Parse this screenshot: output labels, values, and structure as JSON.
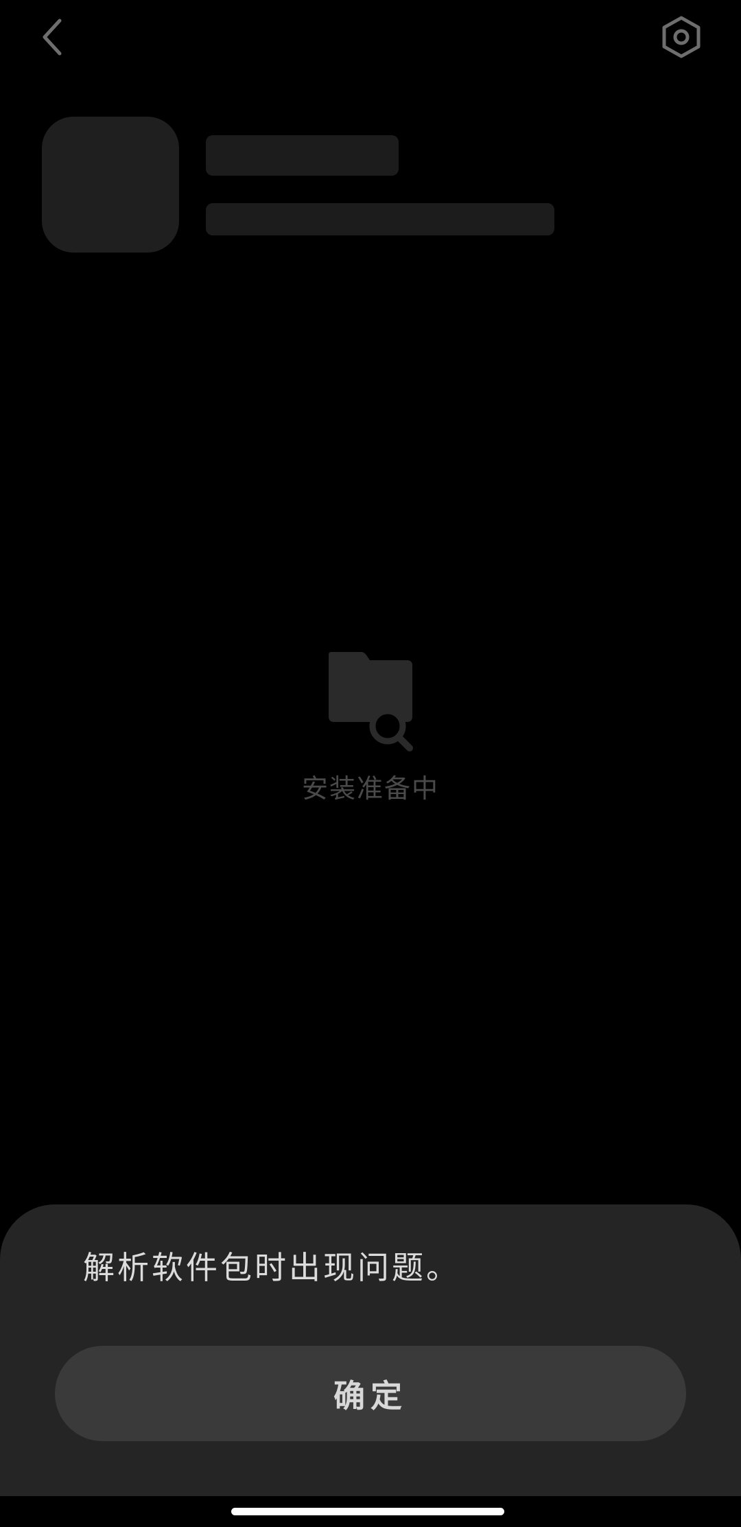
{
  "header": {
    "back_icon": "chevron-left-icon",
    "settings_icon": "hexagon-gear-icon"
  },
  "loading": {
    "icon": "folder-search-icon",
    "status_text": "安装准备中"
  },
  "dialog": {
    "message": "解析软件包时出现问题。",
    "confirm_label": "确定"
  },
  "colors": {
    "background": "#000000",
    "placeholder": "#1c1c1c",
    "sheet": "#252525",
    "button": "#3a3a3a"
  }
}
